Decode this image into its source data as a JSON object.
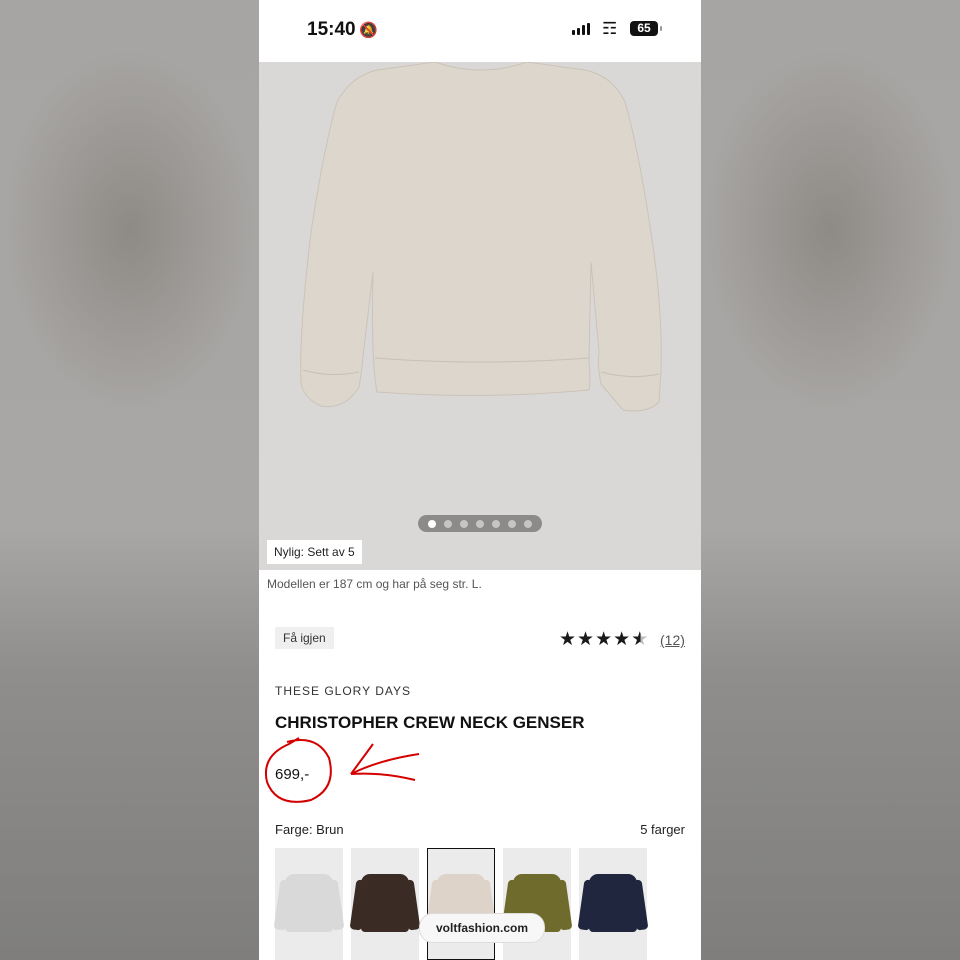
{
  "status_bar": {
    "time": "15:40",
    "battery": "65"
  },
  "product_image": {
    "carousel_total": 7,
    "carousel_active": 1
  },
  "recent_badge": "Nylig: Sett av 5",
  "model_note": "Modellen er 187 cm og har på seg str. L.",
  "back_in_stock_button": "Få igjen",
  "rating": {
    "stars": 4.5,
    "count_label": "(12)"
  },
  "brand": "THESE GLORY DAYS",
  "title": "CHRISTOPHER CREW NECK GENSER",
  "price": "699,-",
  "colors": {
    "label": "Farge: Brun",
    "count_label": "5 farger",
    "swatches": [
      "#d9d9d9",
      "#3a2c25",
      "#ddd3c8",
      "#6e6b2c",
      "#1f263d"
    ],
    "selected_index": 2
  },
  "site_pill": "voltfashion.com",
  "annotation_color": "#d40000"
}
